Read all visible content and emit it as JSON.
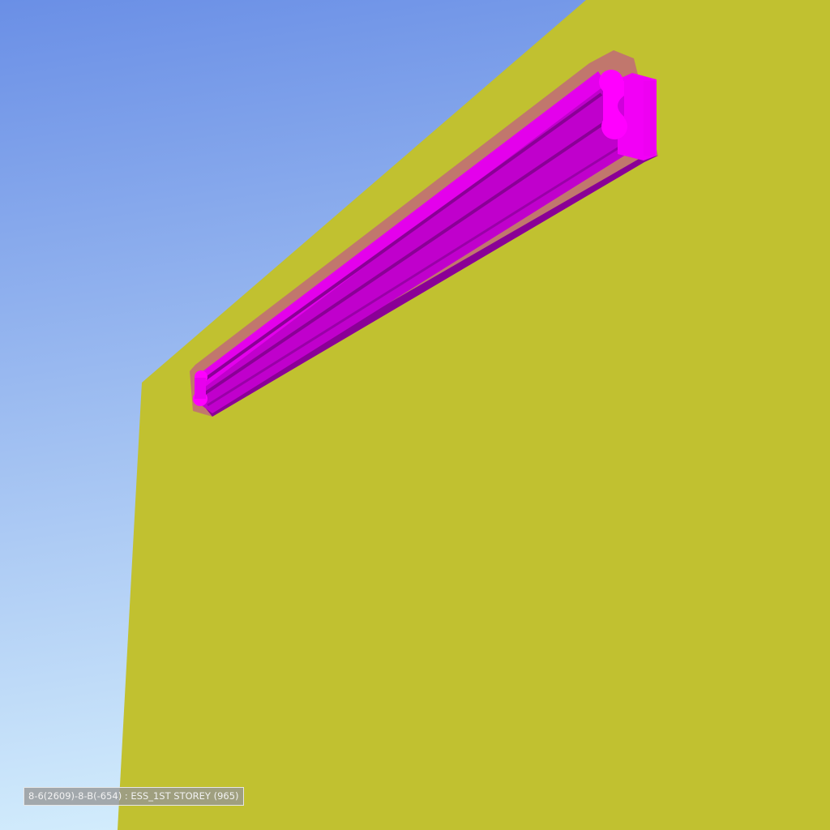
{
  "viewport": {
    "status_label": "8-6(2609)-8-B(-654) : ESS_1ST STOREY (965)"
  },
  "colors": {
    "sky_top": "#6a8fe6",
    "sky_bottom": "#d2ecfc",
    "wall": "#c1c130",
    "element_magenta": "#ff00ff",
    "element_dark": "#b000c0",
    "element_shadow": "#8a0096"
  }
}
